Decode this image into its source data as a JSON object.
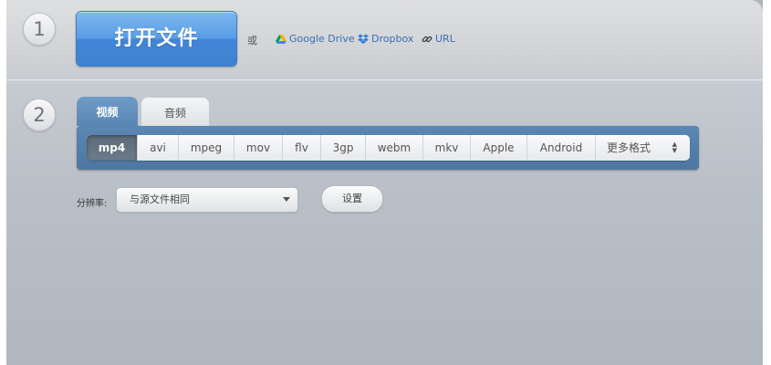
{
  "steps": {
    "one": "1",
    "two": "2"
  },
  "open_button": "打开文件",
  "or_label": "或",
  "sources": [
    {
      "label": "Google Drive",
      "icon": "google-drive-icon"
    },
    {
      "label": "Dropbox",
      "icon": "dropbox-icon"
    },
    {
      "label": "URL",
      "icon": "link-icon"
    }
  ],
  "tabs": [
    {
      "label": "视频",
      "active": true
    },
    {
      "label": "音频",
      "active": false
    }
  ],
  "formats": [
    "mp4",
    "avi",
    "mpeg",
    "mov",
    "flv",
    "3gp",
    "webm",
    "mkv",
    "Apple",
    "Android"
  ],
  "selected_format": "mp4",
  "more_formats": "更多格式",
  "resolution": {
    "label": "分辨率:",
    "value": "与源文件相同"
  },
  "settings_button": "设置",
  "colors": {
    "accent_blue": "#4a8fdc",
    "link_blue": "#3a6fb5",
    "tab_bar": "#5a84b0"
  }
}
